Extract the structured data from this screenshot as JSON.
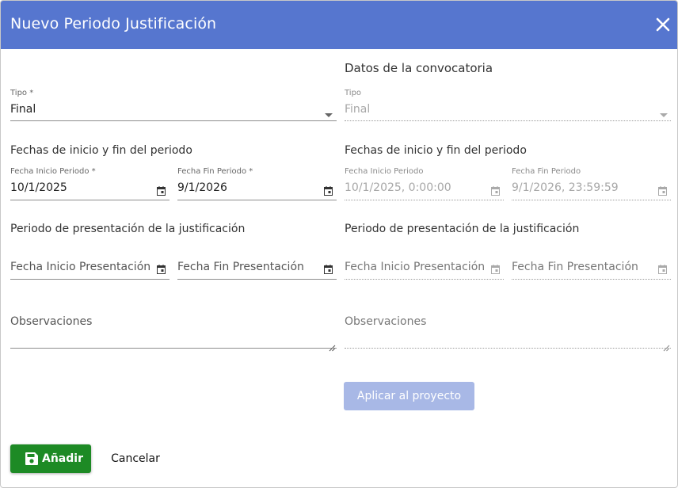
{
  "dialog": {
    "title": "Nuevo Periodo Justificación"
  },
  "convocatoria_heading": "Datos de la convocatoria",
  "left": {
    "tipo": {
      "label": "Tipo *",
      "value": "Final"
    },
    "fechas_heading": "Fechas de inicio y fin del periodo",
    "fecha_inicio": {
      "label": "Fecha Inicio Periodo *",
      "value": "10/1/2025"
    },
    "fecha_fin": {
      "label": "Fecha Fin Periodo *",
      "value": "9/1/2026"
    },
    "presentacion_heading": "Periodo de presentación de la justificación",
    "fecha_inicio_presentacion": {
      "placeholder": "Fecha Inicio Presentación"
    },
    "fecha_fin_presentacion": {
      "placeholder": "Fecha Fin Presentación"
    },
    "observaciones": {
      "placeholder": "Observaciones"
    }
  },
  "right": {
    "tipo": {
      "label": "Tipo",
      "value": "Final"
    },
    "fechas_heading": "Fechas de inicio y fin del periodo",
    "fecha_inicio": {
      "label": "Fecha Inicio Periodo",
      "value": "10/1/2025, 0:00:00"
    },
    "fecha_fin": {
      "label": "Fecha Fin Periodo",
      "value": "9/1/2026, 23:59:59"
    },
    "presentacion_heading": "Periodo de presentación de la justificación",
    "fecha_inicio_presentacion": {
      "placeholder": "Fecha Inicio Presentación"
    },
    "fecha_fin_presentacion": {
      "placeholder": "Fecha Fin Presentación"
    },
    "observaciones": {
      "placeholder": "Observaciones"
    }
  },
  "buttons": {
    "apply": "Aplicar al proyecto",
    "add": "Añadir",
    "cancel": "Cancelar"
  },
  "icons": {
    "close": "close-icon",
    "dropdown": "dropdown-arrow-icon",
    "calendar": "calendar-icon",
    "save": "save-icon",
    "resize": "resize-handle-icon"
  },
  "colors": {
    "header": "#5676cf",
    "add_button": "#1d8a25",
    "apply_button_disabled": "#a8b8e6"
  }
}
